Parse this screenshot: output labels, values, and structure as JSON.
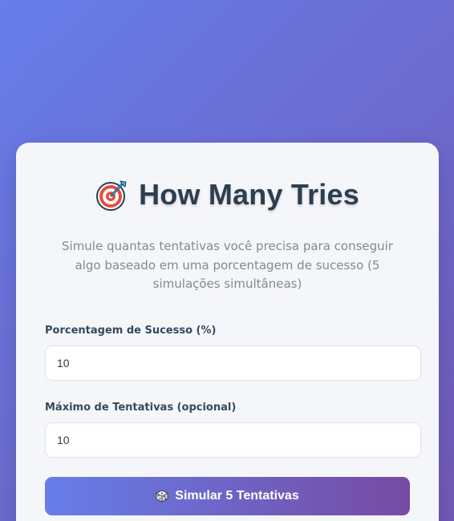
{
  "header": {
    "title": "How Many Tries",
    "icon": "target-icon",
    "subtitle": "Simule quantas tentativas você precisa para conseguir algo baseado em uma porcentagem de sucesso (5 simulações simultâneas)"
  },
  "form": {
    "success_label": "Porcentagem de Sucesso (%)",
    "success_value": "10",
    "max_label": "Máximo de Tentativas (opcional)",
    "max_value": "10",
    "submit_label": "Simular 5 Tentativas",
    "submit_icon": "dice-icon"
  },
  "colors": {
    "gradient_start": "#667eea",
    "gradient_end": "#764ba2",
    "card_bg": "#f5f6fa",
    "title": "#2c3e50"
  }
}
